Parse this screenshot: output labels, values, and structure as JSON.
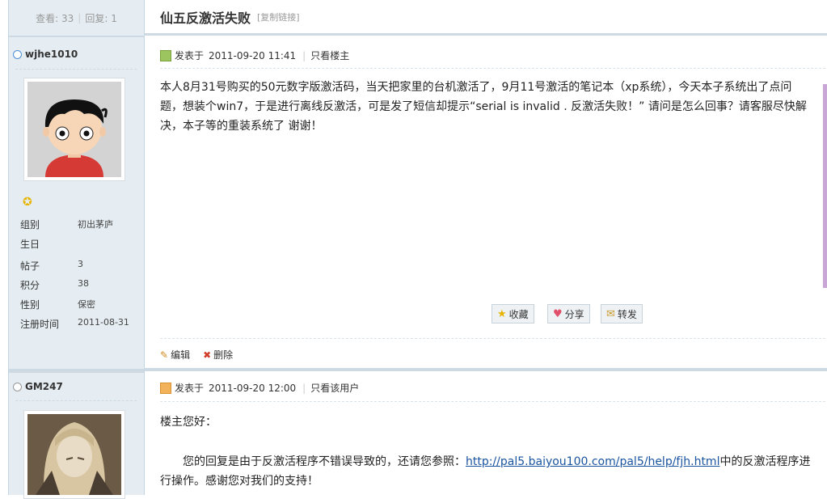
{
  "thread": {
    "views_label": "查看: 33",
    "replies_label": "回复: 1",
    "title": "仙五反激活失败",
    "copy_link": "[复制链接]"
  },
  "post1": {
    "author": "wjhe1010",
    "profile": [
      {
        "label": "组别",
        "value": "初出茅庐"
      },
      {
        "label": "生日",
        "value": ""
      },
      {
        "label": "帖子",
        "value": "3"
      },
      {
        "label": "积分",
        "value": "38"
      },
      {
        "label": "性别",
        "value": "保密"
      },
      {
        "label": "注册时间",
        "value": "2011-08-31"
      }
    ],
    "posted_label": "发表于",
    "time": "2011-09-20 11:41",
    "filter_label": "只看楼主",
    "body": "本人8月31号购买的50元数字版激活码，当天把家里的台机激活了，9月11号激活的笔记本（xp系统），今天本子系统出了点问题，想装个win7，于是进行离线反激活，可是发了短信却提示“serial is invalid . 反激活失败！” 请问是怎么回事？请客服尽快解决，本子等的重装系统了 谢谢！",
    "actions": {
      "favorite": "收藏",
      "share": "分享",
      "forward": "转发"
    },
    "edit": "编辑",
    "delete": "删除"
  },
  "post2": {
    "author": "GM247",
    "posted_label": "发表于",
    "time": "2011-09-20 12:00",
    "filter_label": "只看该用户",
    "greeting": "楼主您好：",
    "body_pre": "您的回复是由于反激活程序不错误导致的，还请您参照：",
    "link": "http://pal5.baiyou100.com/pal5/help/fjh.html",
    "body_post": "中的反激活程序进行操作。感谢您对我们的支持！"
  },
  "colors": {
    "accent": "#c2d5e3",
    "sidebar_bg": "#e5edf2",
    "link": "#1b55a0"
  },
  "icons": [
    "online-status-icon",
    "star-icon",
    "post-icon",
    "favorite-star-icon",
    "share-heart-icon",
    "forward-mail-icon",
    "edit-pencil-icon",
    "delete-x-icon",
    "offline-status-icon"
  ]
}
